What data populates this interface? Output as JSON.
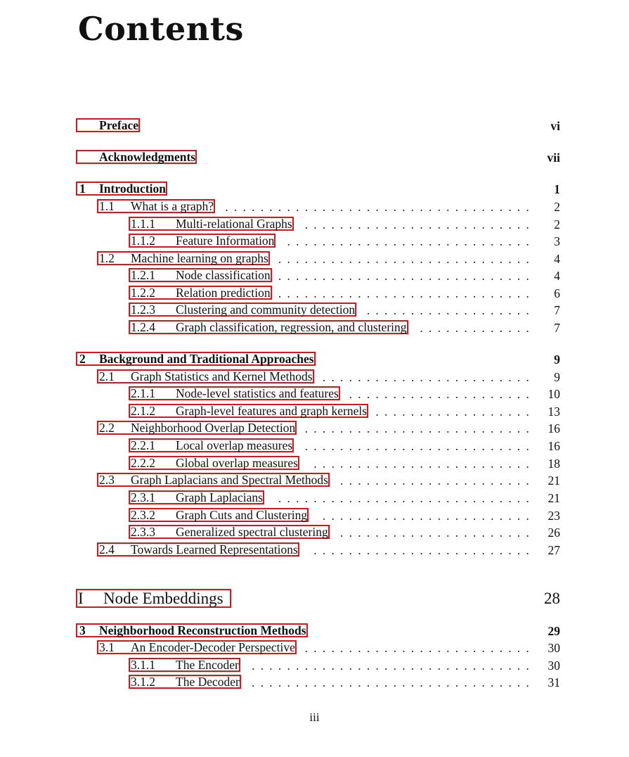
{
  "title": "Contents",
  "entries": [
    {
      "level": "front",
      "num": "",
      "title": "Preface",
      "page": "vi"
    },
    {
      "level": "front",
      "num": "",
      "title": "Acknowledgments",
      "page": "vii"
    },
    {
      "level": "chapter",
      "num": "1",
      "title": "Introduction",
      "page": "1"
    },
    {
      "level": "section",
      "num": "1.1",
      "title": "What is a graph?",
      "page": "2"
    },
    {
      "level": "subsection",
      "num": "1.1.1",
      "title": "Multi-relational Graphs",
      "page": "2"
    },
    {
      "level": "subsection",
      "num": "1.1.2",
      "title": "Feature Information",
      "page": "3"
    },
    {
      "level": "section",
      "num": "1.2",
      "title": "Machine learning on graphs",
      "page": "4"
    },
    {
      "level": "subsection",
      "num": "1.2.1",
      "title": "Node classification",
      "page": "4"
    },
    {
      "level": "subsection",
      "num": "1.2.2",
      "title": "Relation prediction",
      "page": "6"
    },
    {
      "level": "subsection",
      "num": "1.2.3",
      "title": "Clustering and community detection",
      "page": "7"
    },
    {
      "level": "subsection",
      "num": "1.2.4",
      "title": "Graph classification, regression, and clustering",
      "page": "7"
    },
    {
      "level": "chapter",
      "num": "2",
      "title": "Background and Traditional Approaches",
      "page": "9"
    },
    {
      "level": "section",
      "num": "2.1",
      "title": "Graph Statistics and Kernel Methods",
      "page": "9"
    },
    {
      "level": "subsection",
      "num": "2.1.1",
      "title": "Node-level statistics and features",
      "page": "10"
    },
    {
      "level": "subsection",
      "num": "2.1.2",
      "title": "Graph-level features and graph kernels",
      "page": "13"
    },
    {
      "level": "section",
      "num": "2.2",
      "title": "Neighborhood Overlap Detection",
      "page": "16"
    },
    {
      "level": "subsection",
      "num": "2.2.1",
      "title": "Local overlap measures",
      "page": "16"
    },
    {
      "level": "subsection",
      "num": "2.2.2",
      "title": "Global overlap measures",
      "page": "18"
    },
    {
      "level": "section",
      "num": "2.3",
      "title": "Graph Laplacians and Spectral Methods",
      "page": "21"
    },
    {
      "level": "subsection",
      "num": "2.3.1",
      "title": "Graph Laplacians",
      "page": "21"
    },
    {
      "level": "subsection",
      "num": "2.3.2",
      "title": "Graph Cuts and Clustering",
      "page": "23"
    },
    {
      "level": "subsection",
      "num": "2.3.3",
      "title": "Generalized spectral clustering",
      "page": "26"
    },
    {
      "level": "section",
      "num": "2.4",
      "title": "Towards Learned Representations",
      "page": "27"
    },
    {
      "level": "part",
      "num": "I",
      "title": "Node Embeddings",
      "page": "28"
    },
    {
      "level": "chapter",
      "num": "3",
      "title": "Neighborhood Reconstruction Methods",
      "page": "29"
    },
    {
      "level": "section",
      "num": "3.1",
      "title": "An Encoder-Decoder Perspective",
      "page": "30"
    },
    {
      "level": "subsection",
      "num": "3.1.1",
      "title": "The Encoder",
      "page": "30"
    },
    {
      "level": "subsection",
      "num": "3.1.2",
      "title": "The Decoder",
      "page": "31"
    }
  ],
  "footer": {
    "page_number": "iii"
  }
}
